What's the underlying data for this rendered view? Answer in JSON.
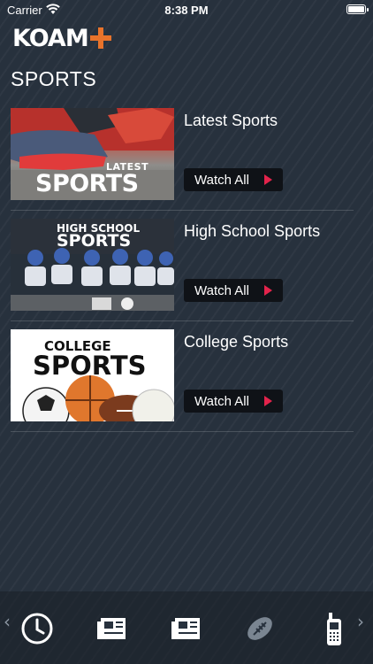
{
  "status_bar": {
    "carrier": "Carrier",
    "time": "8:38 PM"
  },
  "header": {
    "logo_text": "KOAM"
  },
  "page": {
    "title": "SPORTS"
  },
  "feeds": [
    {
      "title": "Latest Sports",
      "button_label": "Watch All",
      "thumb_text": [
        "LATEST",
        "SPORTS"
      ]
    },
    {
      "title": "High School Sports",
      "button_label": "Watch All",
      "thumb_text": [
        "HIGH SCHOOL",
        "SPORTS"
      ]
    },
    {
      "title": "College Sports",
      "button_label": "Watch All",
      "thumb_text": [
        "COLLEGE",
        "SPORTS"
      ]
    }
  ],
  "colors": {
    "background": "#27313d",
    "accent": "#e3234b",
    "logo_plus": "#e8732b"
  },
  "tab_bar": {
    "icons": [
      "clock-icon",
      "news-icon",
      "news-icon",
      "football-icon",
      "phone-icon"
    ],
    "left_arrow": "‹",
    "right_arrow": "›"
  }
}
